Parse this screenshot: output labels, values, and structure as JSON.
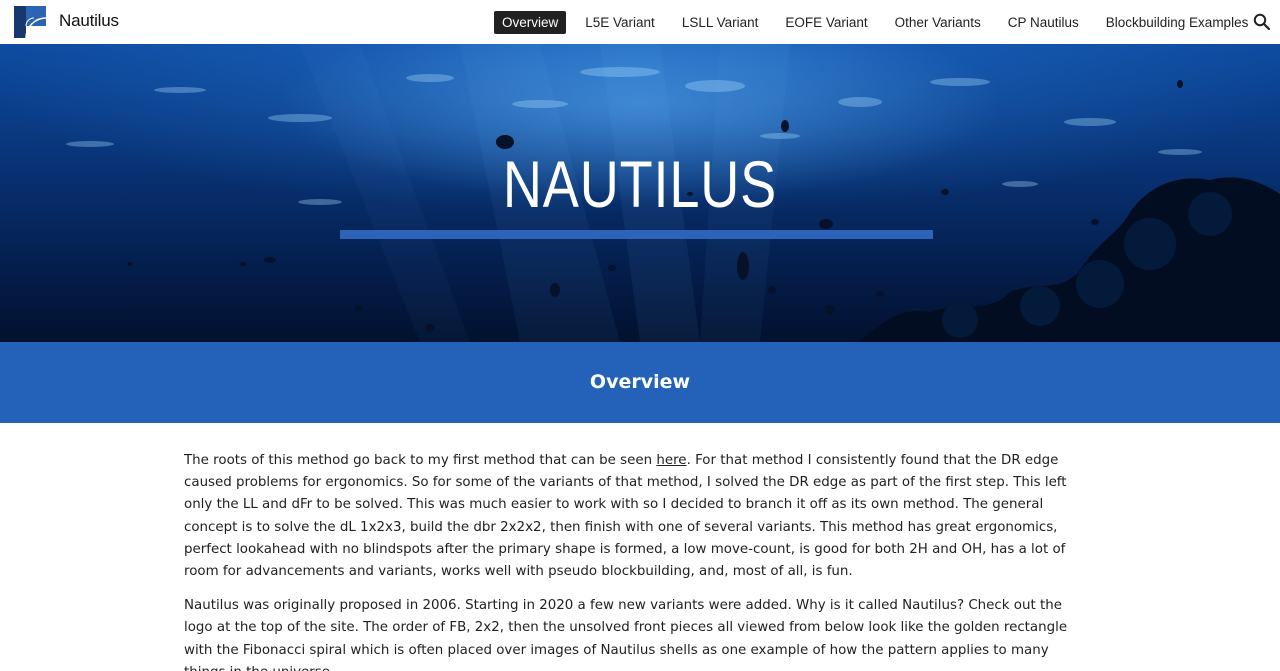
{
  "header": {
    "site_title": "Nautilus",
    "nav": [
      {
        "label": "Overview",
        "active": true
      },
      {
        "label": "L5E Variant",
        "active": false
      },
      {
        "label": "LSLL Variant",
        "active": false
      },
      {
        "label": "EOFE Variant",
        "active": false
      },
      {
        "label": "Other Variants",
        "active": false
      },
      {
        "label": "CP Nautilus",
        "active": false
      },
      {
        "label": "Blockbuilding Examples",
        "active": false
      }
    ],
    "search_icon": "search-icon"
  },
  "hero": {
    "title": "NAUTILUS"
  },
  "banner": {
    "title": "Overview"
  },
  "content": {
    "p1_before_link": "The roots of this method go back to my first method that can be seen ",
    "p1_link": "here",
    "p1_after_link": ". For that method I consistently found that the DR edge caused problems for ergonomics. So for some of the variants of that method, I solved the DR edge as part of the first step. This left only the LL and dFr to be solved. This was much easier to work with so I decided to branch it off as its own method. The general concept is to solve the dL 1x2x3, build the dbr 2x2x2, then finish with one of several variants. This method has great ergonomics, perfect lookahead with no blindspots after the primary shape is formed, a low move-count, is good for both 2H and OH, has a lot of room for advancements and variants, works well with pseudo blockbuilding, and, most of all, is fun.",
    "p2": "Nautilus was originally proposed in 2006. Starting in 2020 a few new variants were added. Why is it called Nautilus? Check out the logo at the top of the site. The order of FB, 2x2, then the unsolved front pieces all viewed from below look like the golden rectangle with the Fibonacci spiral which is often placed over images of Nautilus shells as one example of how the pattern applies to many things in the universe."
  },
  "colors": {
    "banner": "#2362b8",
    "hero_rule": "#2d63b8",
    "nav_active_bg": "#212121"
  }
}
